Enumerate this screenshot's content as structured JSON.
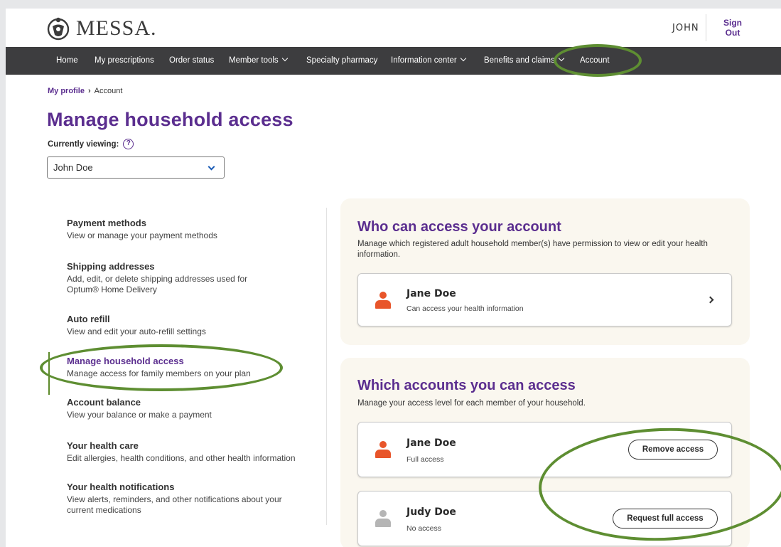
{
  "header": {
    "logo_text": "MESSA.",
    "user_name": "JOHN",
    "sign_out_label": "Sign Out"
  },
  "nav": {
    "items": [
      {
        "label": "Home",
        "has_dropdown": false
      },
      {
        "label": "My prescriptions",
        "has_dropdown": false
      },
      {
        "label": "Order status",
        "has_dropdown": false
      },
      {
        "label": "Member tools",
        "has_dropdown": true
      },
      {
        "label": "Specialty pharmacy",
        "has_dropdown": false
      },
      {
        "label": "Information center",
        "has_dropdown": true
      },
      {
        "label": "Benefits and claims",
        "has_dropdown": true
      },
      {
        "label": "Account",
        "has_dropdown": false
      }
    ]
  },
  "breadcrumb": {
    "link": "My profile",
    "current": "Account"
  },
  "page": {
    "title": "Manage household access",
    "viewing_label": "Currently viewing:",
    "help_glyph": "?",
    "viewing_value": "John Doe"
  },
  "side_menu": {
    "items": [
      {
        "title": "Payment methods",
        "desc": "View or manage your payment methods"
      },
      {
        "title": "Shipping addresses",
        "desc": "Add, edit, or delete shipping addresses used for Optum® Home Delivery"
      },
      {
        "title": "Auto refill",
        "desc": "View and edit your auto-refill settings"
      },
      {
        "title": "Manage household access",
        "desc": "Manage access for family members on your plan",
        "active": true
      },
      {
        "title": "Account balance",
        "desc": "View your balance or make a payment"
      },
      {
        "title": "Your health care",
        "desc": "Edit allergies, health conditions, and other health information"
      },
      {
        "title": "Your health notifications",
        "desc": "View alerts, reminders, and other notifications about your current medications"
      }
    ]
  },
  "who_can_access": {
    "title": "Who can access your account",
    "subtitle": "Manage which registered adult household member(s) have permission to view or edit your health information.",
    "members": [
      {
        "name": "Jane Doe",
        "status": "Can access your health information"
      }
    ]
  },
  "which_accounts": {
    "title": "Which accounts you can access",
    "subtitle": "Manage your access level for each member of your household.",
    "members": [
      {
        "name": "Jane Doe",
        "status": "Full access",
        "button": "Remove access"
      },
      {
        "name": "Judy Doe",
        "status": "No access",
        "button": "Request full access"
      }
    ]
  },
  "colors": {
    "brand_purple": "#5b2e8f",
    "nav_bg": "#3d3d3f",
    "person_active": "#e8552a",
    "person_inactive": "#b5b5b5",
    "annotation_green": "#5e8e32",
    "card_bg": "#faf7ef"
  }
}
